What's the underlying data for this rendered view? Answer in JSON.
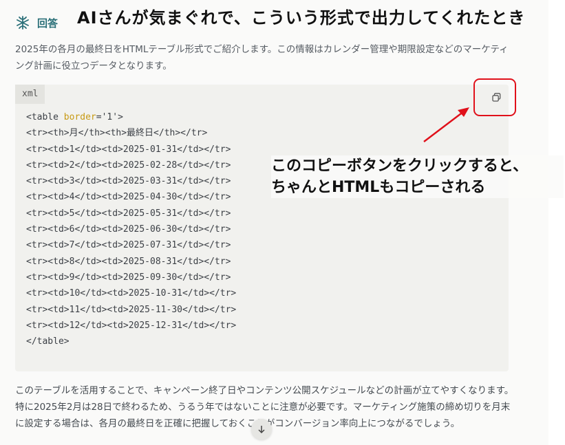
{
  "header": {
    "title": "回答",
    "logo_icon": "assistant-logo-icon"
  },
  "overlay": {
    "title": "AIさんが気まぐれで、こういう形式で出力してくれたとき",
    "annotation_line1": "このコピーボタンをクリックすると、",
    "annotation_line2": "ちゃんとHTMLもコピーされる",
    "highlight_color": "#e0101a"
  },
  "intro": "2025年の各月の最終日をHTMLテーブル形式でご紹介します。この情報はカレンダー管理や期限設定などのマーケティング計画に役立つデータとなります。",
  "code_block": {
    "language": "xml",
    "copy_icon": "copy-icon",
    "first_line_prefix": "<table ",
    "first_line_attr": "border",
    "first_line_suffix": "='1'>",
    "lines": [
      "<tr><th>月</th><th>最終日</th></tr>",
      "<tr><td>1</td><td>2025-01-31</td></tr>",
      "<tr><td>2</td><td>2025-02-28</td></tr>",
      "<tr><td>3</td><td>2025-03-31</td></tr>",
      "<tr><td>4</td><td>2025-04-30</td></tr>",
      "<tr><td>5</td><td>2025-05-31</td></tr>",
      "<tr><td>6</td><td>2025-06-30</td></tr>",
      "<tr><td>7</td><td>2025-07-31</td></tr>",
      "<tr><td>8</td><td>2025-08-31</td></tr>",
      "<tr><td>9</td><td>2025-09-30</td></tr>",
      "<tr><td>10</td><td>2025-10-31</td></tr>",
      "<tr><td>11</td><td>2025-11-30</td></tr>",
      "<tr><td>12</td><td>2025-12-31</td></tr>",
      "</table>"
    ]
  },
  "outro": "このテーブルを活用することで、キャンペーン終了日やコンテンツ公開スケジュールなどの計画が立てやすくなります。特に2025年2月は28日で終わるため、うるう年ではないことに注意が必要です。マーケティング施策の締め切りを月末に設定する場合は、各月の最終日を正確に把握しておくことがコンバージョン率向上につながるでしょう。",
  "scroll_icon": "arrow-down-icon"
}
